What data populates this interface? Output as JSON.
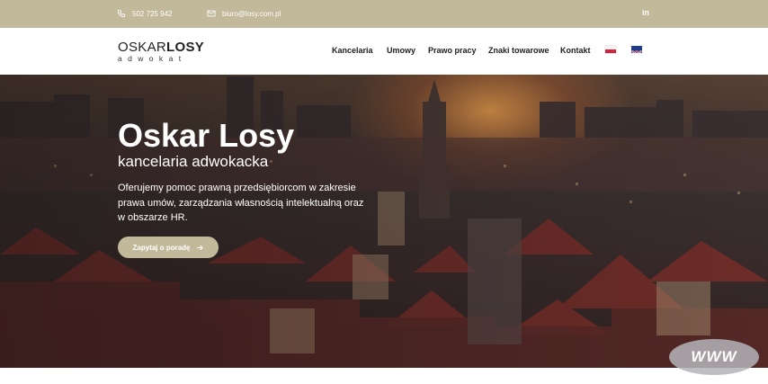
{
  "topbar": {
    "phone": "502 725 942",
    "email": "biuro@losy.com.pl",
    "linkedin": "in"
  },
  "header": {
    "logo_main": "OSKAR",
    "logo_bold": "LOSY",
    "logo_sub": "adwokat",
    "nav": [
      {
        "label": "Kancelaria"
      },
      {
        "label": "Umowy"
      },
      {
        "label": "Prawo pracy"
      },
      {
        "label": "Znaki towarowe"
      },
      {
        "label": "Kontakt"
      }
    ],
    "flags": [
      "pl-flag-icon",
      "uk-flag-icon"
    ]
  },
  "hero": {
    "title": "Oskar Losy",
    "subtitle": "kancelaria adwokacka",
    "text": "Oferujemy pomoc prawną przedsiębiorcom w zakresie prawa umów, zarządzania własnością intelektualną oraz w obszarze HR.",
    "button": "Zapytaj o poradę"
  },
  "badge": "WWW",
  "colors": {
    "accent": "#c2b89a",
    "text": "#222222"
  }
}
